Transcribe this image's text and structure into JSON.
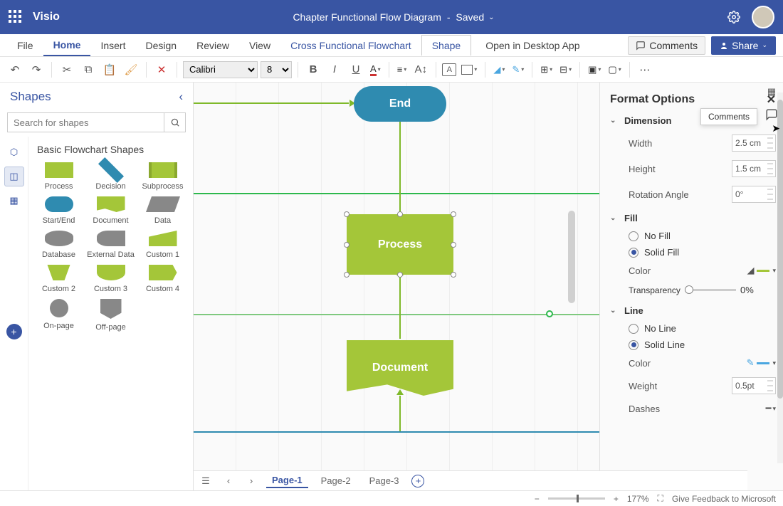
{
  "app_name": "Visio",
  "document": {
    "title": "Chapter Functional Flow Diagram",
    "save_state": "Saved"
  },
  "ribbon_tabs": {
    "file": "File",
    "home": "Home",
    "insert": "Insert",
    "design": "Design",
    "review": "Review",
    "view": "View",
    "cross": "Cross Functional Flowchart",
    "shape": "Shape",
    "open_desktop": "Open in Desktop App"
  },
  "ribbon_right": {
    "comments": "Comments",
    "share": "Share"
  },
  "toolbar": {
    "font_name": "Calibri",
    "font_size": "8"
  },
  "shapes_panel": {
    "title": "Shapes",
    "search_placeholder": "Search for shapes",
    "stencil_title": "Basic Flowchart Shapes",
    "shapes": [
      {
        "label": "Process"
      },
      {
        "label": "Decision"
      },
      {
        "label": "Subprocess"
      },
      {
        "label": "Start/End"
      },
      {
        "label": "Document"
      },
      {
        "label": "Data"
      },
      {
        "label": "Database"
      },
      {
        "label": "External Data"
      },
      {
        "label": "Custom 1"
      },
      {
        "label": "Custom 2"
      },
      {
        "label": "Custom 3"
      },
      {
        "label": "Custom 4"
      },
      {
        "label": "On-page"
      },
      {
        "label": "Off-page"
      }
    ]
  },
  "canvas": {
    "shapes": {
      "end": "End",
      "process": "Process",
      "document": "Document"
    }
  },
  "format_pane": {
    "title": "Format Options",
    "sections": {
      "dimension": {
        "label": "Dimension",
        "width_label": "Width",
        "width_value": "2.5 cm",
        "height_label": "Height",
        "height_value": "1.5 cm",
        "rotation_label": "Rotation Angle",
        "rotation_value": "0°"
      },
      "fill": {
        "label": "Fill",
        "no_fill": "No Fill",
        "solid_fill": "Solid Fill",
        "color_label": "Color",
        "transparency_label": "Transparency",
        "transparency_value": "0%"
      },
      "line": {
        "label": "Line",
        "no_line": "No Line",
        "solid_line": "Solid Line",
        "color_label": "Color",
        "weight_label": "Weight",
        "weight_value": "0.5pt",
        "dashes_label": "Dashes"
      }
    }
  },
  "page_tabs": {
    "p1": "Page-1",
    "p2": "Page-2",
    "p3": "Page-3"
  },
  "statusbar": {
    "zoom": "177%",
    "feedback": "Give Feedback to Microsoft"
  },
  "tooltip": {
    "comments": "Comments"
  }
}
